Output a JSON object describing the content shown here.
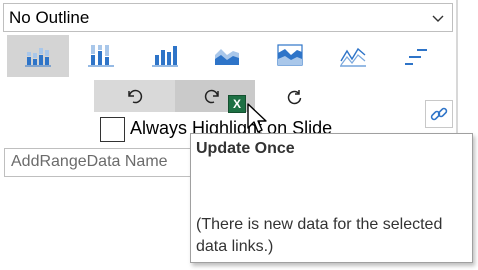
{
  "outline_select": {
    "value": "No Outline"
  },
  "chart_types": [
    {
      "name": "stacked-column-icon",
      "selected": true
    },
    {
      "name": "100pct-stacked-column-icon",
      "selected": false
    },
    {
      "name": "clustered-column-icon",
      "selected": false
    },
    {
      "name": "area-icon",
      "selected": false
    },
    {
      "name": "stacked-area-icon",
      "selected": false
    },
    {
      "name": "line-icon",
      "selected": false
    },
    {
      "name": "dash-line-icon",
      "selected": false
    }
  ],
  "actions": [
    {
      "name": "undo-icon"
    },
    {
      "name": "redo-update-icon"
    },
    {
      "name": "refresh-icon"
    }
  ],
  "excel_badge": "X",
  "highlight_checkbox": {
    "label": "Always Highlight on Slide",
    "checked": false
  },
  "range_input": {
    "placeholder": "AddRangeData Name"
  },
  "tooltip": {
    "title": "Update Once",
    "body": "(There is new data for the selected data links.)"
  },
  "colors": {
    "chart_blue": "#2e74c8",
    "excel_green": "#1d7044"
  }
}
